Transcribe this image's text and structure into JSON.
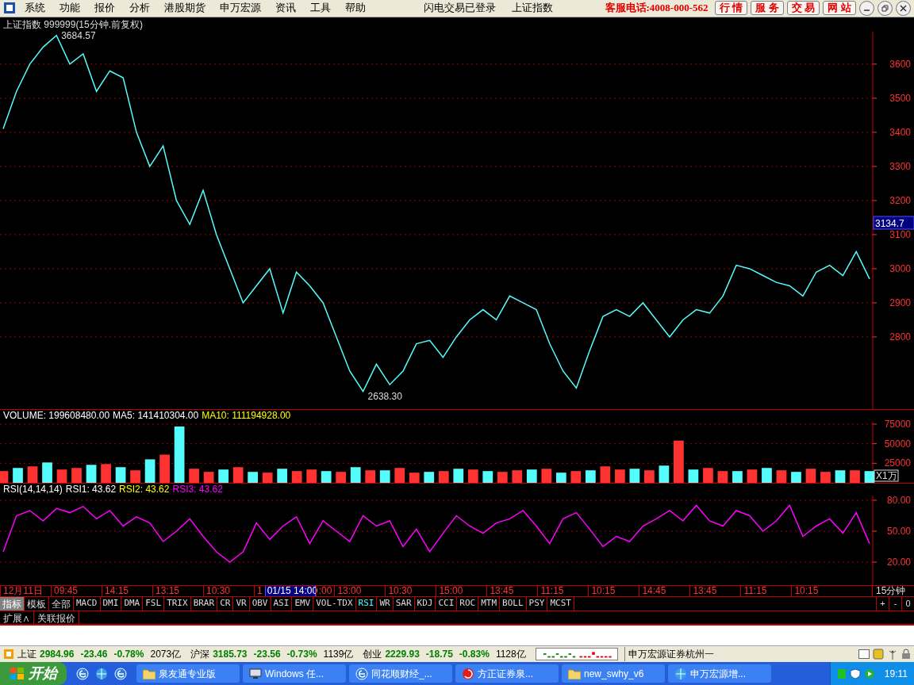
{
  "menu": [
    "系统",
    "功能",
    "报价",
    "分析",
    "港股期货",
    "申万宏源",
    "资讯",
    "工具",
    "帮助"
  ],
  "status_texts": [
    "闪电交易已登录",
    "上证指数"
  ],
  "hotline": "客服电话:4008-000-562",
  "quick_buttons": [
    "行 情",
    "服 务",
    "交 易",
    "网 站"
  ],
  "price_panel": {
    "title": "上证指数 999999(15分钟.前复权)",
    "last_price_tag": "3134.7",
    "chart_data": {
      "type": "line",
      "grid": true,
      "ylim": [
        2586,
        3695
      ],
      "yticks": [
        2800,
        2900,
        3000,
        3100,
        3200,
        3300,
        3400,
        3500,
        3600
      ],
      "series": [
        {
          "color": "#54fcfc",
          "values": [
            3410,
            3520,
            3600,
            3650,
            3684,
            3600,
            3630,
            3520,
            3580,
            3560,
            3400,
            3300,
            3360,
            3200,
            3130,
            3230,
            3100,
            3000,
            2900,
            2950,
            3000,
            2870,
            2990,
            2950,
            2900,
            2800,
            2700,
            2640,
            2720,
            2660,
            2700,
            2780,
            2790,
            2740,
            2800,
            2850,
            2880,
            2850,
            2920,
            2900,
            2880,
            2780,
            2700,
            2650,
            2760,
            2860,
            2880,
            2860,
            2900,
            2850,
            2800,
            2850,
            2880,
            2870,
            2920,
            3010,
            3000,
            2980,
            2960,
            2950,
            2920,
            2990,
            3010,
            2980,
            3050,
            2970
          ]
        }
      ],
      "annotations": [
        "3684.57",
        "2638.30"
      ]
    }
  },
  "volume_panel": {
    "labels": [
      {
        "text": "VOLUME: 199608480.00",
        "color": "#ffffff"
      },
      {
        "text": "MA5: 141410304.00",
        "color": "#ffffff"
      },
      {
        "text": "MA10: 111194928.00",
        "color": "#ffff00"
      }
    ],
    "unit": "X1万",
    "chart_data": {
      "type": "bar",
      "grid": true,
      "ylim": [
        0,
        78000
      ],
      "yticks": [
        25000,
        50000,
        75000
      ],
      "series": [
        {
          "color": "#ff3232",
          "values": [
            15000,
            null,
            21000,
            null,
            17000,
            19000,
            null,
            24000,
            null,
            16000,
            null,
            36000,
            null,
            18000,
            14000,
            null,
            20000,
            null,
            13000,
            null,
            15000,
            17000,
            null,
            14000,
            null,
            16000,
            null,
            19000,
            13000,
            null,
            15000,
            null,
            17000,
            null,
            14000,
            16000,
            null,
            18000,
            null,
            15000,
            null,
            21000,
            17000,
            null,
            16000,
            null,
            54000,
            null,
            19000,
            15000,
            null,
            17000,
            null,
            16000,
            null,
            18000,
            14000,
            null,
            16000,
            null
          ]
        },
        {
          "color": "#54fcfc",
          "values": [
            null,
            19000,
            null,
            26000,
            null,
            null,
            23000,
            null,
            20000,
            null,
            30000,
            null,
            72000,
            null,
            null,
            17000,
            null,
            14000,
            null,
            18000,
            null,
            null,
            15000,
            null,
            20000,
            null,
            16000,
            null,
            null,
            14000,
            null,
            18000,
            null,
            15000,
            null,
            null,
            17000,
            null,
            13000,
            null,
            16000,
            null,
            null,
            18000,
            null,
            22000,
            null,
            17000,
            null,
            null,
            15000,
            null,
            19000,
            null,
            14000,
            null,
            null,
            16000,
            null,
            15000
          ]
        }
      ]
    }
  },
  "rsi_panel": {
    "labels": [
      {
        "text": "RSI(14,14,14)",
        "color": "#ffffff"
      },
      {
        "text": "RSI1: 43.62",
        "color": "#ffffff"
      },
      {
        "text": "RSI2: 43.62",
        "color": "#ffff00"
      },
      {
        "text": "RSI3: 43.62",
        "color": "#ff00ff"
      }
    ],
    "chart_data": {
      "type": "line",
      "grid": true,
      "ylim": [
        -2.3,
        84.6
      ],
      "yticks": [
        {
          "value": 20,
          "label": "20.00"
        },
        {
          "value": 50,
          "label": "50.00"
        },
        {
          "value": 80,
          "label": "80.00"
        }
      ],
      "series": [
        {
          "color": "#ff00ff",
          "values": [
            30,
            65,
            70,
            60,
            72,
            68,
            74,
            62,
            70,
            55,
            64,
            58,
            40,
            50,
            62,
            45,
            30,
            20,
            30,
            58,
            42,
            55,
            64,
            38,
            60,
            50,
            40,
            65,
            55,
            60,
            35,
            52,
            30,
            48,
            65,
            55,
            48,
            58,
            62,
            70,
            55,
            38,
            62,
            68,
            52,
            35,
            45,
            40,
            55,
            62,
            70,
            60,
            75,
            60,
            55,
            70,
            65,
            50,
            60,
            75,
            45,
            55,
            62,
            48,
            68,
            38
          ]
        }
      ]
    }
  },
  "time_axis": [
    {
      "text": "12月11日",
      "selected": false
    },
    {
      "text": "09:45",
      "selected": false
    },
    {
      "text": "14:15",
      "selected": false
    },
    {
      "text": "13:15",
      "selected": false
    },
    {
      "text": "10:30",
      "selected": false
    },
    {
      "text": "1",
      "selected": false
    },
    {
      "text": "01/15 14:00",
      "selected": true
    },
    {
      "text": ":00",
      "selected": false
    },
    {
      "text": "13:00",
      "selected": false
    },
    {
      "text": "10:30",
      "selected": false
    },
    {
      "text": "15:00",
      "selected": false
    },
    {
      "text": "13:45",
      "selected": false
    },
    {
      "text": "11:15",
      "selected": false
    },
    {
      "text": "10:15",
      "selected": false
    },
    {
      "text": "14:45",
      "selected": false
    },
    {
      "text": "13:45",
      "selected": false
    },
    {
      "text": "11:15",
      "selected": false
    },
    {
      "text": "10:15",
      "selected": false
    }
  ],
  "period": "15分钟",
  "indicator_tabs": [
    {
      "label": "指标",
      "selected": true,
      "kind": "group"
    },
    {
      "label": "模板",
      "selected": false,
      "kind": "group"
    },
    {
      "label": "全部",
      "selected": false,
      "kind": "group"
    },
    {
      "label": "MACD",
      "selected": false,
      "kind": "indicator"
    },
    {
      "label": "DMI",
      "selected": false,
      "kind": "indicator"
    },
    {
      "label": "DMA",
      "selected": false,
      "kind": "indicator"
    },
    {
      "label": "FSL",
      "selected": false,
      "kind": "indicator"
    },
    {
      "label": "TRIX",
      "selected": false,
      "kind": "indicator"
    },
    {
      "label": "BRAR",
      "selected": false,
      "kind": "indicator"
    },
    {
      "label": "CR",
      "selected": false,
      "kind": "indicator"
    },
    {
      "label": "VR",
      "selected": false,
      "kind": "indicator"
    },
    {
      "label": "OBV",
      "selected": false,
      "kind": "indicator"
    },
    {
      "label": "ASI",
      "selected": false,
      "kind": "indicator"
    },
    {
      "label": "EMV",
      "selected": false,
      "kind": "indicator"
    },
    {
      "label": "VOL-TDX",
      "selected": false,
      "kind": "indicator"
    },
    {
      "label": "RSI",
      "selected": true,
      "kind": "indicator"
    },
    {
      "label": "WR",
      "selected": false,
      "kind": "indicator"
    },
    {
      "label": "SAR",
      "selected": false,
      "kind": "indicator"
    },
    {
      "label": "KDJ",
      "selected": false,
      "kind": "indicator"
    },
    {
      "label": "CCI",
      "selected": false,
      "kind": "indicator"
    },
    {
      "label": "ROC",
      "selected": false,
      "kind": "indicator"
    },
    {
      "label": "MTM",
      "selected": false,
      "kind": "indicator"
    },
    {
      "label": "BOLL",
      "selected": false,
      "kind": "indicator"
    },
    {
      "label": "PSY",
      "selected": false,
      "kind": "indicator"
    },
    {
      "label": "MCST",
      "selected": false,
      "kind": "indicator"
    }
  ],
  "zoom_buttons": [
    "+",
    "-",
    "0"
  ],
  "sub_tabs": [
    "扩展∧",
    "关联报价"
  ],
  "indices": [
    {
      "name": "上证",
      "value": "2984.96",
      "change": "-23.46",
      "pct": "-0.78%",
      "amount": "2073亿"
    },
    {
      "name": "沪深",
      "value": "3185.73",
      "change": "-23.56",
      "pct": "-0.73%",
      "amount": "1139亿"
    },
    {
      "name": "创业",
      "value": "2229.93",
      "change": "-18.75",
      "pct": "-0.83%",
      "amount": "1128亿"
    }
  ],
  "broker": "申万宏源证券杭州一",
  "taskbar": {
    "start": "开始",
    "tasks": [
      {
        "label": "泉友通专业版",
        "kind": "folder"
      },
      {
        "label": "Windows 任...",
        "kind": "monitor"
      },
      {
        "label": "同花顺财经_...",
        "kind": "browser"
      },
      {
        "label": "方正证券泉...",
        "kind": "swirl"
      },
      {
        "label": "new_swhy_v6",
        "kind": "folder"
      },
      {
        "label": "申万宏源增...",
        "kind": "globe"
      }
    ],
    "clock": "19:11"
  }
}
